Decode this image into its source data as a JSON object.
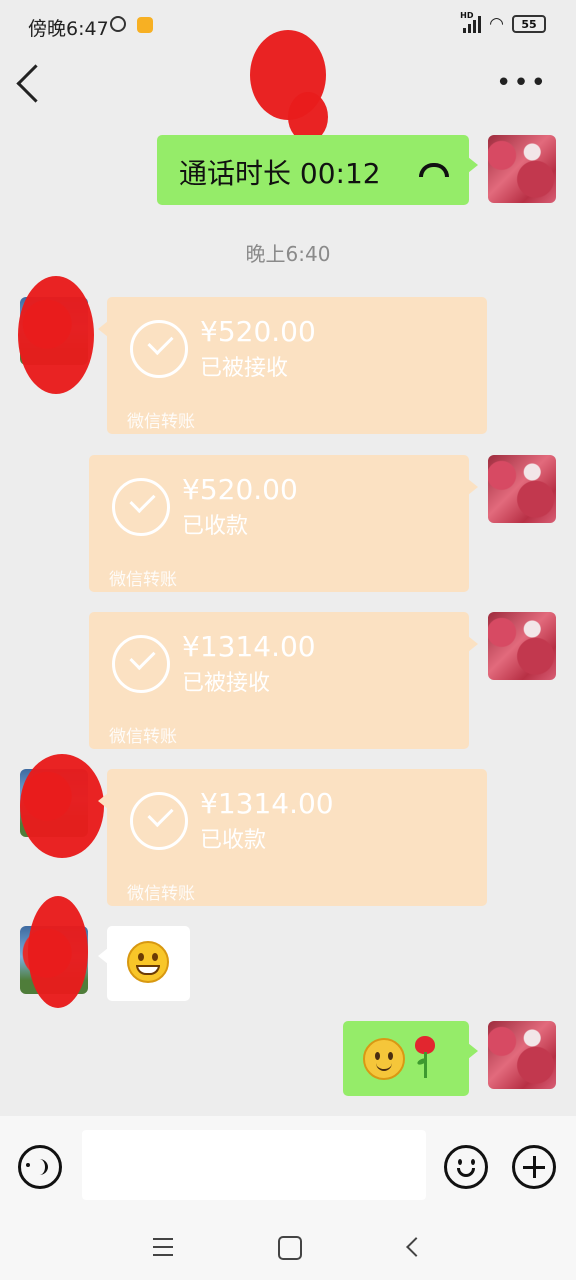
{
  "status_bar": {
    "time": "傍晚6:47",
    "battery": "55",
    "hd_label": "HD"
  },
  "header": {
    "back_icon": "chevron-left-icon",
    "more_icon": "more-dots-icon"
  },
  "messages": {
    "call": {
      "text": "通话时长 00:12",
      "icon": "phone-hangup-icon"
    },
    "time_separator": "晚上6:40",
    "transfers": [
      {
        "amount": "¥520.00",
        "status": "已被接收",
        "label": "微信转账",
        "side": "other"
      },
      {
        "amount": "¥520.00",
        "status": "已收款",
        "label": "微信转账",
        "side": "me"
      },
      {
        "amount": "¥1314.00",
        "status": "已被接收",
        "label": "微信转账",
        "side": "me"
      },
      {
        "amount": "¥1314.00",
        "status": "已收款",
        "label": "微信转账",
        "side": "other"
      }
    ],
    "emoji_other": "grinning-face-icon",
    "emoji_me": [
      "smile-face-icon",
      "rose-icon"
    ]
  },
  "input_bar": {
    "voice_icon": "voice-input-icon",
    "emoji_icon": "emoji-icon",
    "plus_icon": "plus-icon",
    "placeholder": ""
  },
  "nav_bar": {
    "icons": [
      "menu-icon",
      "home-icon",
      "back-icon"
    ]
  },
  "colors": {
    "background": "#ededed",
    "my_bubble": "#95ec69",
    "transfer_card": "#fbe1c2",
    "redaction": "#e81c1c"
  }
}
